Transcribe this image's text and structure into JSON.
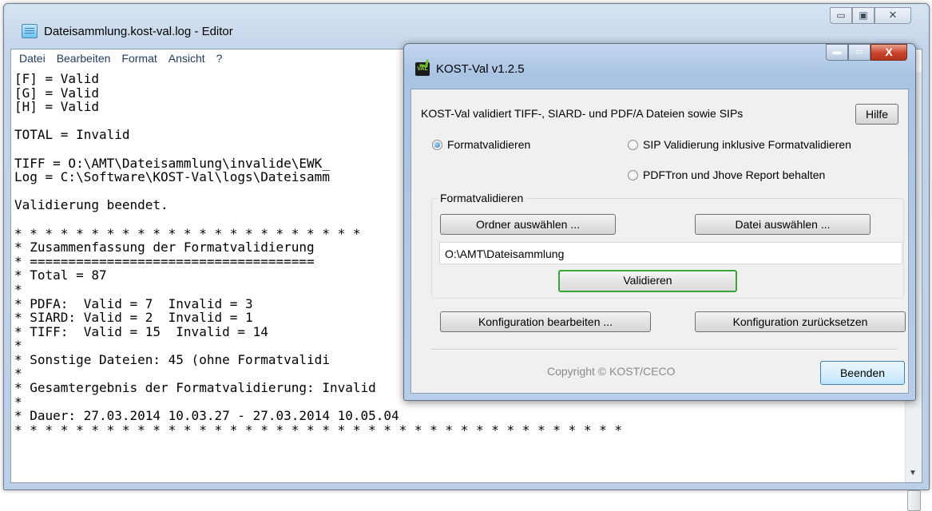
{
  "editor": {
    "title": "Dateisammlung.kost-val.log - Editor",
    "caption": {
      "minimize": "▭",
      "maximize": "▣",
      "close": "✕"
    },
    "menu": [
      "Datei",
      "Bearbeiten",
      "Format",
      "Ansicht",
      "?"
    ],
    "lines": [
      "[F] = Valid",
      "[G] = Valid",
      "[H] = Valid",
      "",
      "TOTAL = Invalid",
      "",
      "TIFF = O:\\AMT\\Dateisammlung\\invalide\\EWK_",
      "Log = C:\\Software\\KOST-Val\\logs\\Dateisamm",
      "",
      "Validierung beendet.",
      "",
      "* * * * * * * * * * * * * * * * * * * * * * *",
      "* Zusammenfassung der Formatvalidierung",
      "* =====================================",
      "* Total = 87",
      "*",
      "* PDFA:  Valid = 7  Invalid = 3",
      "* SIARD: Valid = 2  Invalid = 1",
      "* TIFF:  Valid = 15  Invalid = 14",
      "*",
      "* Sonstige Dateien: 45 (ohne Formatvalidi",
      "*",
      "* Gesamtergebnis der Formatvalidierung: Invalid",
      "*",
      "* Dauer: 27.03.2014 10.03.27 - 27.03.2014 10.05.04",
      "* * * * * * * * * * * * * * * * * * * * * * * * * * * * * * * * * * * * * * * *"
    ],
    "scroll_arrow": "▼"
  },
  "dialog": {
    "title": "KOST-Val v1.2.5",
    "logo_text": "VAL",
    "caption": {
      "minimize": "▬",
      "maximize": "▭",
      "close": "X"
    },
    "description": "KOST-Val validiert TIFF-, SIARD- und PDF/A Dateien sowie SIPs",
    "help_button": "Hilfe",
    "radio_format": "Formatvalidieren",
    "radio_sip": "SIP Validierung inklusive Formatvalidieren",
    "radio_report": "PDFTron und Jhove Report behalten",
    "group_label": "Formatvalidieren",
    "folder_button": "Ordner auswählen ...",
    "file_button": "Datei auswählen ...",
    "path_value": "O:\\AMT\\Dateisammlung",
    "validate_button": "Validieren",
    "config_edit_button": "Konfiguration bearbeiten ...",
    "config_reset_button": "Konfiguration zurücksetzen",
    "copyright": "Copyright © KOST/CECO",
    "exit_button": "Beenden"
  }
}
